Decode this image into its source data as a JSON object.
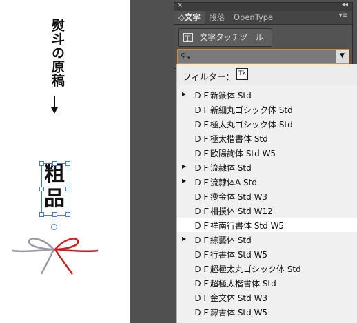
{
  "artboard": {
    "title_vertical": "熨斗の原稿",
    "noshi_chars": [
      "粗",
      "品"
    ]
  },
  "panel": {
    "tabs": [
      {
        "label": "◇文字",
        "active": true
      },
      {
        "label": "段落",
        "active": false
      },
      {
        "label": "OpenType",
        "active": false
      }
    ],
    "close_glyph": "×",
    "collapse_glyph": "◂◂",
    "menu_glyph": "▾≡",
    "touch_tool_label": "文字タッチツール",
    "search": {
      "value": "",
      "icon_glyph": "⚲"
    }
  },
  "font_dropdown": {
    "filter_label": "フィルター：",
    "filter_icon_text": "Tk",
    "items": [
      {
        "name": "ＤＦ新篆体 Std",
        "has_submenu": true,
        "selected": false
      },
      {
        "name": "ＤＦ新細丸ゴシック体 Std",
        "has_submenu": false,
        "selected": false
      },
      {
        "name": "ＤＦ極太丸ゴシック体 Std",
        "has_submenu": false,
        "selected": false
      },
      {
        "name": "ＤＦ極太楷書体 Std",
        "has_submenu": false,
        "selected": false
      },
      {
        "name": "ＤＦ欧陽詢体 Std W5",
        "has_submenu": false,
        "selected": false
      },
      {
        "name": "ＤＦ流隷体 Std",
        "has_submenu": true,
        "selected": false
      },
      {
        "name": "ＤＦ流隷体A Std",
        "has_submenu": true,
        "selected": false
      },
      {
        "name": "ＤＦ痩金体 Std W3",
        "has_submenu": false,
        "selected": false
      },
      {
        "name": "ＤＦ相撲体 Std W12",
        "has_submenu": false,
        "selected": false
      },
      {
        "name": "ＤＦ祥南行書体 Std W5",
        "has_submenu": false,
        "selected": true
      },
      {
        "name": "ＤＦ綜藝体 Std",
        "has_submenu": true,
        "selected": false
      },
      {
        "name": "ＤＦ行書体 Std W5",
        "has_submenu": false,
        "selected": false
      },
      {
        "name": "ＤＦ超極太丸ゴシック体 Std",
        "has_submenu": false,
        "selected": false
      },
      {
        "name": "ＤＦ超極太楷書体 Std",
        "has_submenu": false,
        "selected": false
      },
      {
        "name": "ＤＦ金文体 Std W3",
        "has_submenu": false,
        "selected": false
      },
      {
        "name": "ＤＦ隷書体 Std W5",
        "has_submenu": false,
        "selected": false
      }
    ]
  },
  "colors": {
    "workspace_bg": "#505050",
    "panel_bg": "#535353",
    "focus_ring": "#e08a1e",
    "selection_blue": "#4a7bd6",
    "ribbon_red": "#cc1f1f",
    "ribbon_gray": "#9a9aa6"
  }
}
